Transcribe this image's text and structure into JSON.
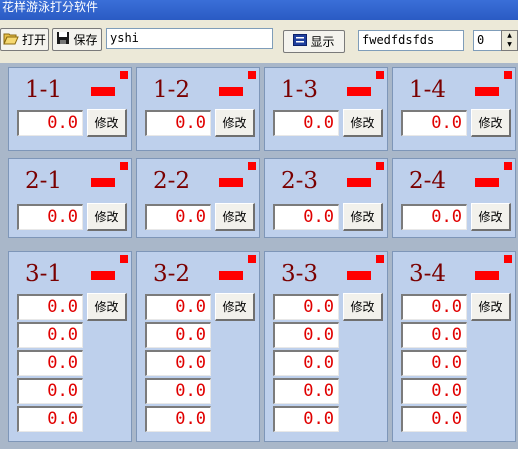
{
  "window": {
    "title": "花样游泳打分软件"
  },
  "toolbar": {
    "open_label": "打开",
    "save_label": "保存",
    "name_value": "yshi",
    "display_label": "显示",
    "code_value": "fwedfdsfds",
    "count_value": "0"
  },
  "panel_button_label": "修改",
  "panels": [
    {
      "label": "1-1",
      "scores": [
        "0.0"
      ]
    },
    {
      "label": "1-2",
      "scores": [
        "0.0"
      ]
    },
    {
      "label": "1-3",
      "scores": [
        "0.0"
      ]
    },
    {
      "label": "1-4",
      "scores": [
        "0.0"
      ]
    },
    {
      "label": "2-1",
      "scores": [
        "0.0"
      ]
    },
    {
      "label": "2-2",
      "scores": [
        "0.0"
      ]
    },
    {
      "label": "2-3",
      "scores": [
        "0.0"
      ]
    },
    {
      "label": "2-4",
      "scores": [
        "0.0"
      ]
    },
    {
      "label": "3-1",
      "scores": [
        "0.0",
        "0.0",
        "0.0",
        "0.0",
        "0.0"
      ]
    },
    {
      "label": "3-2",
      "scores": [
        "0.0",
        "0.0",
        "0.0",
        "0.0",
        "0.0"
      ]
    },
    {
      "label": "3-3",
      "scores": [
        "0.0",
        "0.0",
        "0.0",
        "0.0",
        "0.0"
      ]
    },
    {
      "label": "3-4",
      "scores": [
        "0.0",
        "0.0",
        "0.0",
        "0.0",
        "0.0"
      ]
    }
  ],
  "colors": {
    "accent_red": "#ff0000",
    "panel_bg": "#bed0ec",
    "label_color": "#7a0000"
  }
}
